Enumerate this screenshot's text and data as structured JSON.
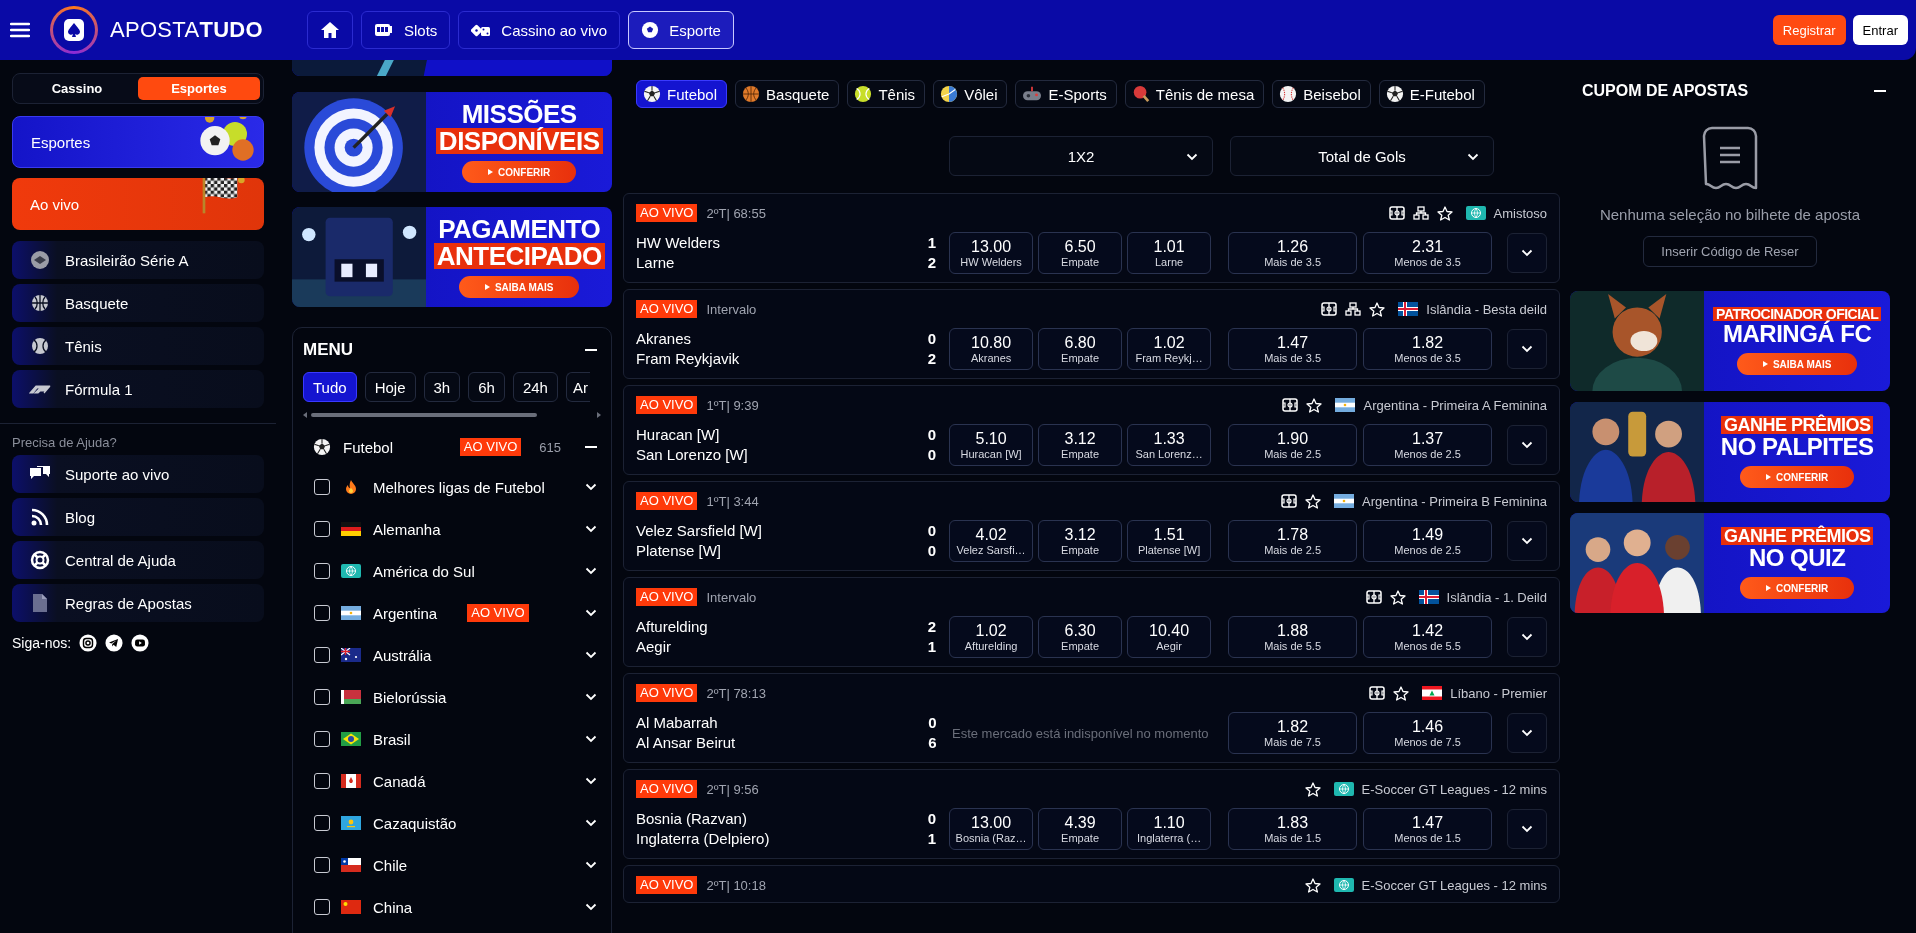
{
  "header": {
    "logo": "APOSTA**TUDO**",
    "nav": [
      {
        "kind": "home",
        "selected": false
      },
      {
        "kind": "slots",
        "label": "Slots",
        "selected": false
      },
      {
        "kind": "dice",
        "label": "Cassino ao vivo",
        "selected": false
      },
      {
        "kind": "soccer",
        "label": "Esporte",
        "selected": true
      }
    ],
    "auth": [
      {
        "label": "Registrar",
        "kind": "primary"
      },
      {
        "label": "Entrar",
        "kind": "secondary"
      }
    ]
  },
  "sidebar": {
    "tabs": [
      {
        "label": "Cassino",
        "selected": false
      },
      {
        "label": "Esportes",
        "selected": true
      }
    ],
    "promos": [
      {
        "label": "Esportes",
        "kind": "sports"
      },
      {
        "label": "Ao vivo",
        "kind": "live"
      }
    ],
    "sports": [
      {
        "label": "Brasileirão Série A",
        "kind": "league"
      },
      {
        "label": "Basquete",
        "kind": "basketball"
      },
      {
        "label": "Tênis",
        "kind": "tennis"
      },
      {
        "label": "Fórmula 1",
        "kind": "f1"
      }
    ],
    "help_title": "Precisa de Ajuda?",
    "help": [
      {
        "label": "Suporte ao vivo",
        "kind": "chat"
      },
      {
        "label": "Blog",
        "kind": "rss"
      },
      {
        "label": "Central de Ajuda",
        "kind": "lifebuoy"
      },
      {
        "label": "Regras de Apostas",
        "kind": "document"
      }
    ],
    "social_label": "Siga-nos:",
    "social": [
      {
        "kind": "camera"
      },
      {
        "kind": "plane"
      },
      {
        "kind": "play"
      }
    ]
  },
  "promo_banners": [
    {
      "kind": "cut"
    },
    {
      "kind": "target",
      "lines": [
        {
          "text": "MISSÕES",
          "highlight": false
        },
        {
          "text": "DISPONÍVEIS",
          "highlight": true
        }
      ],
      "button": "CONFERIR"
    },
    {
      "kind": "stadium",
      "lines": [
        {
          "text": "PAGAMENTO",
          "highlight": false
        },
        {
          "text": "ANTECIPADO",
          "highlight": true
        }
      ],
      "button": "SAIBA MAIS"
    }
  ],
  "menu": {
    "title": "MENU",
    "filters": [
      {
        "label": "Tudo",
        "selected": true
      },
      {
        "label": "Hoje",
        "selected": false
      },
      {
        "label": "3h",
        "selected": false
      },
      {
        "label": "6h",
        "selected": false
      },
      {
        "label": "24h",
        "selected": false
      },
      {
        "label": "Ar",
        "selected": false
      }
    ],
    "sport": {
      "label": "Futebol",
      "badge": "AO VIVO",
      "count": "615"
    },
    "regions": [
      {
        "label": "Melhores ligas de Futebol",
        "kind": "fire",
        "checked": false
      },
      {
        "label": "Alemanha",
        "kind": "germany",
        "checked": false
      },
      {
        "label": "América do Sul",
        "kind": "globe",
        "checked": false
      },
      {
        "label": "Argentina",
        "kind": "argentina",
        "checked": false,
        "badge": "AO VIVO"
      },
      {
        "label": "Austrália",
        "kind": "australia",
        "checked": false
      },
      {
        "label": "Bielorússia",
        "kind": "belarus",
        "checked": false
      },
      {
        "label": "Brasil",
        "kind": "brazil",
        "checked": false
      },
      {
        "label": "Canadá",
        "kind": "canada",
        "checked": false
      },
      {
        "label": "Cazaquistão",
        "kind": "kazakhstan",
        "checked": false
      },
      {
        "label": "Chile",
        "kind": "chile",
        "checked": false
      },
      {
        "label": "China",
        "kind": "china",
        "checked": false
      }
    ]
  },
  "main": {
    "sports": [
      {
        "label": "Futebol",
        "kind": "soccer",
        "selected": true
      },
      {
        "label": "Basquete",
        "kind": "basketball",
        "selected": false
      },
      {
        "label": "Tênis",
        "kind": "tennis",
        "selected": false
      },
      {
        "label": "Vôlei",
        "kind": "volleyball",
        "selected": false
      },
      {
        "label": "E-Sports",
        "kind": "gamepad",
        "selected": false
      },
      {
        "label": "Tênis de mesa",
        "kind": "paddle",
        "selected": false
      },
      {
        "label": "Beisebol",
        "kind": "baseball",
        "selected": false
      },
      {
        "label": "E-Futebol",
        "kind": "soccer",
        "selected": false
      }
    ],
    "markets": [
      {
        "label": "1X2"
      },
      {
        "label": "Total de Gols"
      }
    ],
    "events": [
      {
        "badge": "AO VIVO",
        "clock": "2ºT| 68:55",
        "stats": true,
        "tree": true,
        "kind": "globe",
        "league": "Amistoso",
        "home": "HW Welders",
        "away": "Larne",
        "home_score": "1",
        "away_score": "2",
        "odds_1x2": [
          {
            "odd": "13.00",
            "label": "HW Welders"
          },
          {
            "odd": "6.50",
            "label": "Empate"
          },
          {
            "odd": "1.01",
            "label": "Larne"
          }
        ],
        "odds_total": [
          {
            "odd": "1.26",
            "label": "Mais de 3.5"
          },
          {
            "odd": "2.31",
            "label": "Menos de 3.5"
          }
        ]
      },
      {
        "badge": "AO VIVO",
        "clock": "Intervalo",
        "stats": true,
        "tree": true,
        "kind": "iceland",
        "league": "Islândia - Besta deild",
        "home": "Akranes",
        "away": "Fram Reykjavik",
        "home_score": "0",
        "away_score": "2",
        "odds_1x2": [
          {
            "odd": "10.80",
            "label": "Akranes"
          },
          {
            "odd": "6.80",
            "label": "Empate"
          },
          {
            "odd": "1.02",
            "label": "Fram Reykj…"
          }
        ],
        "odds_total": [
          {
            "odd": "1.47",
            "label": "Mais de 3.5"
          },
          {
            "odd": "1.82",
            "label": "Menos de 3.5"
          }
        ]
      },
      {
        "badge": "AO VIVO",
        "clock": "1ºT| 9:39",
        "stats": true,
        "tree": false,
        "kind": "argentina",
        "league": "Argentina - Primeira A Feminina",
        "home": "Huracan [W]",
        "away": "San Lorenzo [W]",
        "home_score": "0",
        "away_score": "0",
        "odds_1x2": [
          {
            "odd": "5.10",
            "label": "Huracan [W]"
          },
          {
            "odd": "3.12",
            "label": "Empate"
          },
          {
            "odd": "1.33",
            "label": "San Lorenz…"
          }
        ],
        "odds_total": [
          {
            "odd": "1.90",
            "label": "Mais de 2.5"
          },
          {
            "odd": "1.37",
            "label": "Menos de 2.5"
          }
        ]
      },
      {
        "badge": "AO VIVO",
        "clock": "1ºT| 3:44",
        "stats": true,
        "tree": false,
        "kind": "argentina",
        "league": "Argentina - Primeira B Feminina",
        "home": "Velez Sarsfield [W]",
        "away": "Platense [W]",
        "home_score": "0",
        "away_score": "0",
        "odds_1x2": [
          {
            "odd": "4.02",
            "label": "Velez Sarsfi…"
          },
          {
            "odd": "3.12",
            "label": "Empate"
          },
          {
            "odd": "1.51",
            "label": "Platense [W]"
          }
        ],
        "odds_total": [
          {
            "odd": "1.78",
            "label": "Mais de 2.5"
          },
          {
            "odd": "1.49",
            "label": "Menos de 2.5"
          }
        ]
      },
      {
        "badge": "AO VIVO",
        "clock": "Intervalo",
        "stats": true,
        "tree": false,
        "kind": "iceland",
        "league": "Islândia - 1. Deild",
        "home": "Afturelding",
        "away": "Aegir",
        "home_score": "2",
        "away_score": "1",
        "odds_1x2": [
          {
            "odd": "1.02",
            "label": "Afturelding"
          },
          {
            "odd": "6.30",
            "label": "Empate"
          },
          {
            "odd": "10.40",
            "label": "Aegir"
          }
        ],
        "odds_total": [
          {
            "odd": "1.88",
            "label": "Mais de 5.5"
          },
          {
            "odd": "1.42",
            "label": "Menos de 5.5"
          }
        ]
      },
      {
        "badge": "AO VIVO",
        "clock": "2ºT| 78:13",
        "stats": true,
        "tree": false,
        "kind": "lebanon",
        "league": "Líbano - Premier",
        "home": "Al Mabarrah",
        "away": "Al Ansar Beirut",
        "home_score": "0",
        "away_score": "6",
        "unavailable": "Este mercado está indisponível no momento",
        "odds_total": [
          {
            "odd": "1.82",
            "label": "Mais de 7.5"
          },
          {
            "odd": "1.46",
            "label": "Menos de 7.5"
          }
        ]
      },
      {
        "badge": "AO VIVO",
        "clock": "2ºT| 9:56",
        "stats": false,
        "tree": false,
        "kind": "globe",
        "league": "E-Soccer GT Leagues - 12 mins",
        "home": "Bosnia (Razvan)",
        "away": "Inglaterra (Delpiero)",
        "home_score": "0",
        "away_score": "1",
        "odds_1x2": [
          {
            "odd": "13.00",
            "label": "Bosnia (Raz…"
          },
          {
            "odd": "4.39",
            "label": "Empate"
          },
          {
            "odd": "1.10",
            "label": "Inglaterra (…"
          }
        ],
        "odds_total": [
          {
            "odd": "1.83",
            "label": "Mais de 1.5"
          },
          {
            "odd": "1.47",
            "label": "Menos de 1.5"
          }
        ]
      },
      {
        "badge": "AO VIVO",
        "clock": "2ºT| 10:18",
        "stats": false,
        "tree": false,
        "kind": "globe",
        "league": "E-Soccer GT Leagues - 12 mins"
      }
    ]
  },
  "coupon": {
    "title": "CUPOM DE APOSTAS",
    "empty_text": "Nenhuma seleção no bilhete de aposta",
    "code_placeholder": "Inserir Código de Reser"
  },
  "side_banners": [
    {
      "kind": "mascot",
      "lines": [
        {
          "text": "PATROCINADOR OFICIAL",
          "highlight": true
        },
        {
          "text": "MARINGÁ FC",
          "highlight": false
        }
      ],
      "button": "SAIBA MAIS"
    },
    {
      "kind": "players",
      "lines": [
        {
          "text": "GANHE PRÊMIOS",
          "highlight": true
        },
        {
          "text": "NO PALPITES",
          "highlight": false
        }
      ],
      "button": "CONFERIR"
    },
    {
      "kind": "team",
      "lines": [
        {
          "text": "GANHE PRÊMIOS",
          "highlight": true
        },
        {
          "text": "NO QUIZ",
          "highlight": false
        }
      ],
      "button": "CONFERIR"
    }
  ]
}
